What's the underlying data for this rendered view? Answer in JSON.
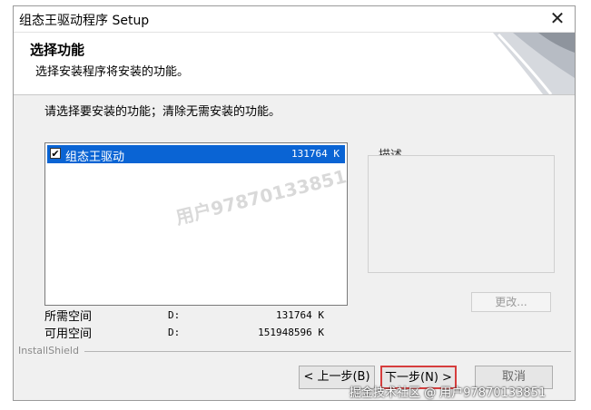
{
  "window": {
    "title": "组态王驱动程序 Setup",
    "close_glyph": "✕"
  },
  "header": {
    "title": "选择功能",
    "subtitle": "选择安装程序将安装的功能。"
  },
  "instruction": "请选择要安装的功能；清除无需安装的功能。",
  "features": [
    {
      "name": "组态王驱动",
      "size": "131764 K",
      "checked": true,
      "check_glyph": "✔"
    }
  ],
  "description": {
    "label": "描述"
  },
  "change_button": "更改...",
  "space": {
    "required": {
      "label": "所需空间",
      "drive": "D:",
      "value": "131764 K"
    },
    "available": {
      "label": "可用空间",
      "drive": "D:",
      "value": "151948596 K"
    }
  },
  "installshield_label": "InstallShield",
  "buttons": {
    "back": "< 上一步(B)",
    "next": "下一步(N) >",
    "cancel": "取消"
  },
  "watermarks": {
    "center": "用户97870133851",
    "footer": "掘金技术社区 @ 用户97870133851"
  },
  "colors": {
    "selection": "#0a64d4",
    "highlight_border": "#d63d3d"
  }
}
